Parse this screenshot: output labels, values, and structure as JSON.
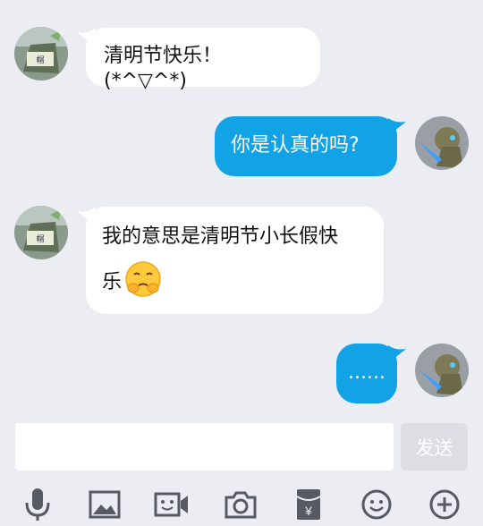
{
  "messages": [
    {
      "side": "in",
      "text": "清明节快乐！ (*^▽^*)"
    },
    {
      "side": "out",
      "text": "你是认真的吗?"
    },
    {
      "side": "in",
      "text_line1": "我的意思是清明节小长假快",
      "text_line2": "乐",
      "emoji": "worried-face-emoji"
    },
    {
      "side": "out",
      "text": "......"
    }
  ],
  "composer": {
    "input_value": "",
    "send_label": "发送"
  },
  "toolbar": {
    "icons": [
      "microphone-icon",
      "image-icon",
      "video-icon",
      "camera-icon",
      "red-packet-icon",
      "emoji-icon",
      "plus-icon"
    ]
  },
  "colors": {
    "background": "#ebedf2",
    "incoming_bubble": "#ffffff",
    "outgoing_bubble": "#12a3e6",
    "send_button": "#dcdee3",
    "icon": "#555a63"
  }
}
